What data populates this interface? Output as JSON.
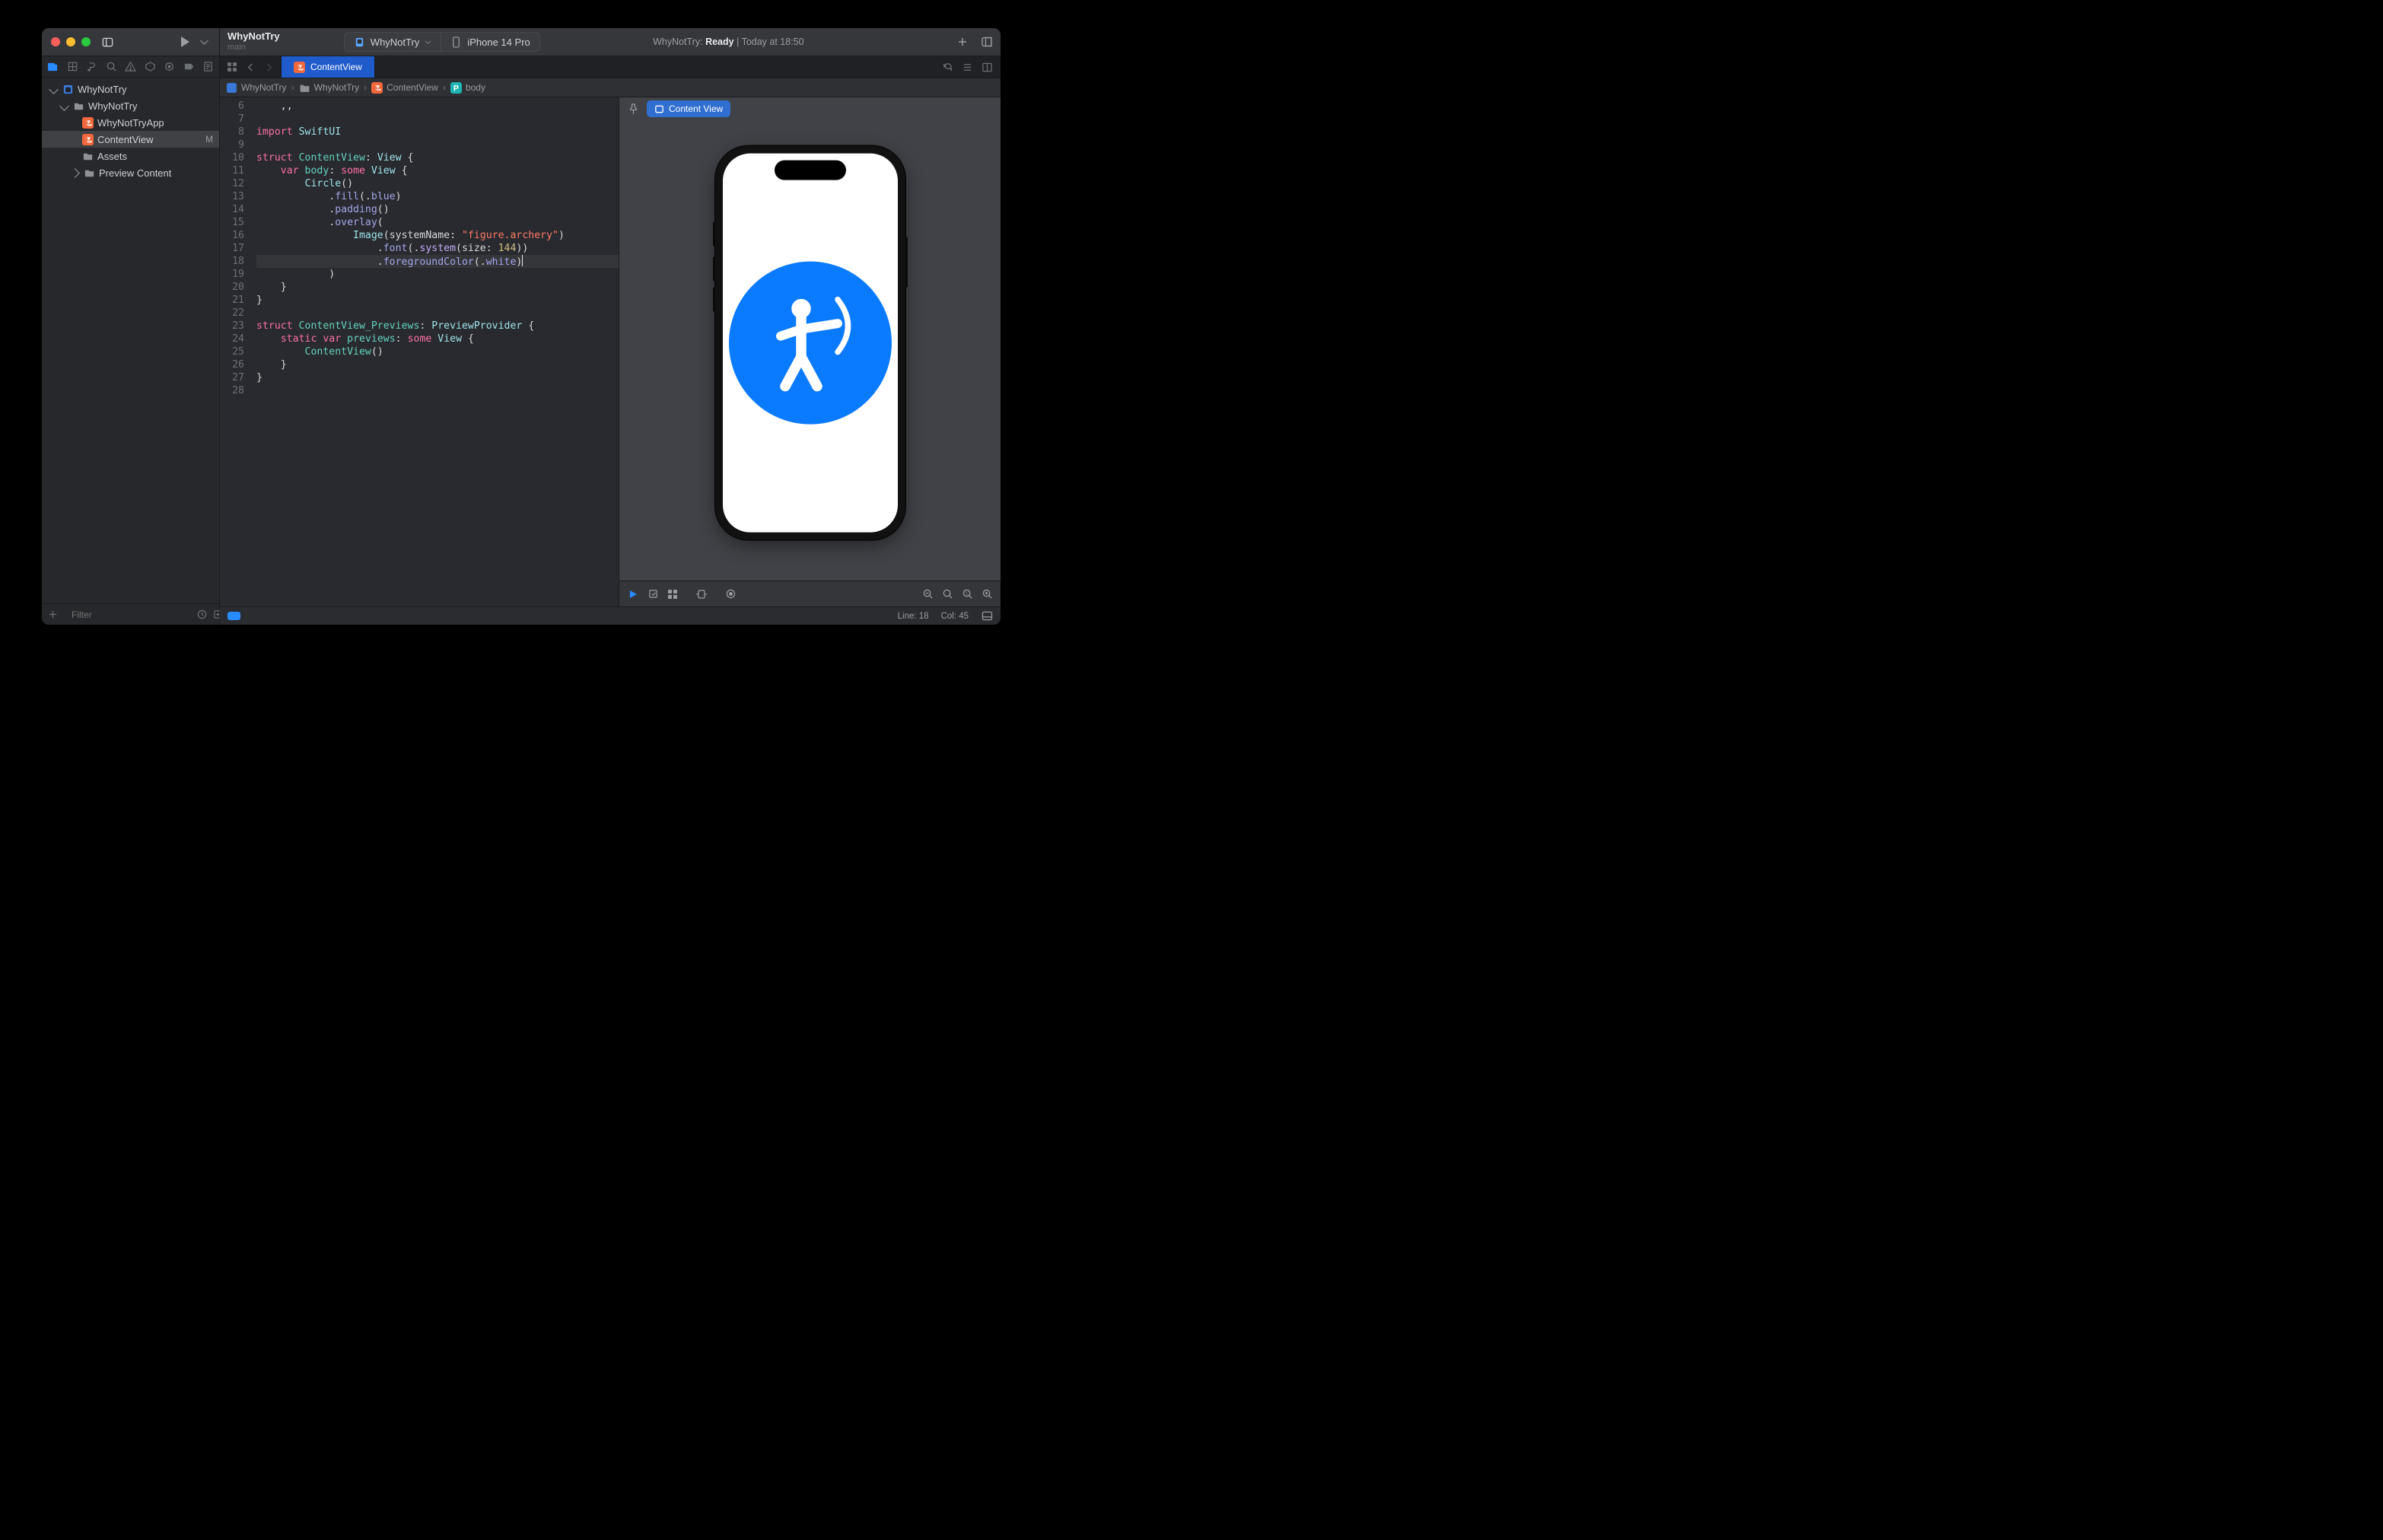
{
  "project": {
    "name": "WhyNotTry",
    "branch": "main"
  },
  "scheme": {
    "target": "WhyNotTry",
    "device": "iPhone 14 Pro"
  },
  "activity": {
    "prefix": "WhyNotTry: ",
    "status": "Ready",
    "time": "Today at 18:50"
  },
  "tab": {
    "name": "ContentView"
  },
  "jumpbar": {
    "project": "WhyNotTry",
    "folder": "WhyNotTry",
    "file": "ContentView",
    "symbol": "body"
  },
  "nav": {
    "project": "WhyNotTry",
    "folder": "WhyNotTry",
    "items": {
      "appfile": "WhyNotTryApp",
      "content": "ContentView",
      "content_badge": "M",
      "assets": "Assets",
      "preview": "Preview Content"
    },
    "filter_placeholder": "Filter"
  },
  "canvas": {
    "pill": "Content View"
  },
  "code": {
    "first_line": 6,
    "highlight_index": 12,
    "lines": [
      {
        "tokens": [
          {
            "t": "    ,,",
            "c": ""
          }
        ]
      },
      {
        "tokens": []
      },
      {
        "tokens": [
          {
            "t": "import",
            "c": "kw"
          },
          {
            "t": " "
          },
          {
            "t": "SwiftUI",
            "c": "ty"
          }
        ]
      },
      {
        "tokens": []
      },
      {
        "tokens": [
          {
            "t": "struct",
            "c": "kw"
          },
          {
            "t": " "
          },
          {
            "t": "ContentView",
            "c": "ty2"
          },
          {
            "t": ": "
          },
          {
            "t": "View",
            "c": "ty"
          },
          {
            "t": " {"
          }
        ]
      },
      {
        "tokens": [
          {
            "t": "    "
          },
          {
            "t": "var",
            "c": "kw"
          },
          {
            "t": " "
          },
          {
            "t": "body",
            "c": "pr"
          },
          {
            "t": ": "
          },
          {
            "t": "some",
            "c": "kw"
          },
          {
            "t": " "
          },
          {
            "t": "View",
            "c": "ty"
          },
          {
            "t": " {"
          }
        ]
      },
      {
        "tokens": [
          {
            "t": "        "
          },
          {
            "t": "Circle",
            "c": "ty"
          },
          {
            "t": "()"
          }
        ]
      },
      {
        "tokens": [
          {
            "t": "            ."
          },
          {
            "t": "fill",
            "c": "fn"
          },
          {
            "t": "(."
          },
          {
            "t": "blue",
            "c": "en"
          },
          {
            "t": ")"
          }
        ]
      },
      {
        "tokens": [
          {
            "t": "            ."
          },
          {
            "t": "padding",
            "c": "fn"
          },
          {
            "t": "()"
          }
        ]
      },
      {
        "tokens": [
          {
            "t": "            ."
          },
          {
            "t": "overlay",
            "c": "fn"
          },
          {
            "t": "("
          }
        ]
      },
      {
        "tokens": [
          {
            "t": "                "
          },
          {
            "t": "Image",
            "c": "ty"
          },
          {
            "t": "(systemName: "
          },
          {
            "t": "\"figure.archery\"",
            "c": "st"
          },
          {
            "t": ")"
          }
        ]
      },
      {
        "tokens": [
          {
            "t": "                    ."
          },
          {
            "t": "font",
            "c": "fn"
          },
          {
            "t": "(."
          },
          {
            "t": "system",
            "c": "fn2"
          },
          {
            "t": "(size: "
          },
          {
            "t": "144",
            "c": "nm"
          },
          {
            "t": "))"
          }
        ]
      },
      {
        "tokens": [
          {
            "t": "                    ."
          },
          {
            "t": "foregroundColor",
            "c": "fn"
          },
          {
            "t": "(."
          },
          {
            "t": "white",
            "c": "en"
          },
          {
            "t": ")"
          }
        ],
        "caret": true
      },
      {
        "tokens": [
          {
            "t": "            )"
          }
        ]
      },
      {
        "tokens": [
          {
            "t": "    }"
          }
        ]
      },
      {
        "tokens": [
          {
            "t": "}"
          }
        ]
      },
      {
        "tokens": []
      },
      {
        "tokens": [
          {
            "t": "struct",
            "c": "kw"
          },
          {
            "t": " "
          },
          {
            "t": "ContentView_Previews",
            "c": "ty2"
          },
          {
            "t": ": "
          },
          {
            "t": "PreviewProvider",
            "c": "ty"
          },
          {
            "t": " {"
          }
        ]
      },
      {
        "tokens": [
          {
            "t": "    "
          },
          {
            "t": "static",
            "c": "kw"
          },
          {
            "t": " "
          },
          {
            "t": "var",
            "c": "kw"
          },
          {
            "t": " "
          },
          {
            "t": "previews",
            "c": "pr"
          },
          {
            "t": ": "
          },
          {
            "t": "some",
            "c": "kw"
          },
          {
            "t": " "
          },
          {
            "t": "View",
            "c": "ty"
          },
          {
            "t": " {"
          }
        ]
      },
      {
        "tokens": [
          {
            "t": "        "
          },
          {
            "t": "ContentView",
            "c": "ty2"
          },
          {
            "t": "()"
          }
        ]
      },
      {
        "tokens": [
          {
            "t": "    }"
          }
        ]
      },
      {
        "tokens": [
          {
            "t": "}"
          }
        ]
      },
      {
        "tokens": []
      }
    ]
  },
  "status": {
    "line": "Line: 18",
    "col": "Col: 45"
  }
}
